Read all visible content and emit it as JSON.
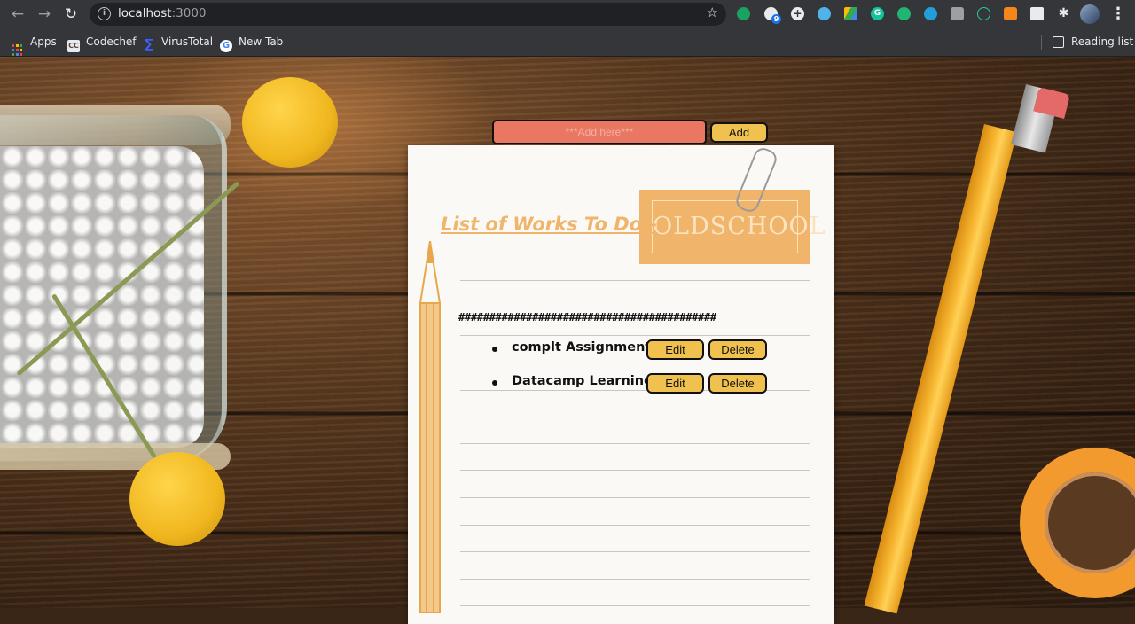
{
  "browser": {
    "url_host": "localhost",
    "url_port": ":3000",
    "extension_badge": "9",
    "bookmarks": [
      {
        "label": "Apps",
        "icon": "apps-grid-icon"
      },
      {
        "label": "Codechef",
        "icon": "codechef-icon"
      },
      {
        "label": "VirusTotal",
        "icon": "virustotal-icon"
      },
      {
        "label": "New Tab",
        "icon": "google-icon"
      }
    ],
    "reading_list": "Reading list"
  },
  "app": {
    "input_placeholder": "***Add here***",
    "input_value": "",
    "add_label": "Add",
    "title": "List of Works To Do:-",
    "logo_text": "OLDSCHOOL",
    "separator": "##########################################",
    "todos": [
      {
        "text": "complt Assignment",
        "edit_label": "Edit",
        "delete_label": "Delete"
      },
      {
        "text": "Datacamp Learning",
        "edit_label": "Edit",
        "delete_label": "Delete"
      }
    ]
  },
  "colors": {
    "input_bg": "#ea7762",
    "button_bg": "#f0c14e",
    "title_color": "#f0b56a",
    "chrome_bg": "#35363a"
  }
}
